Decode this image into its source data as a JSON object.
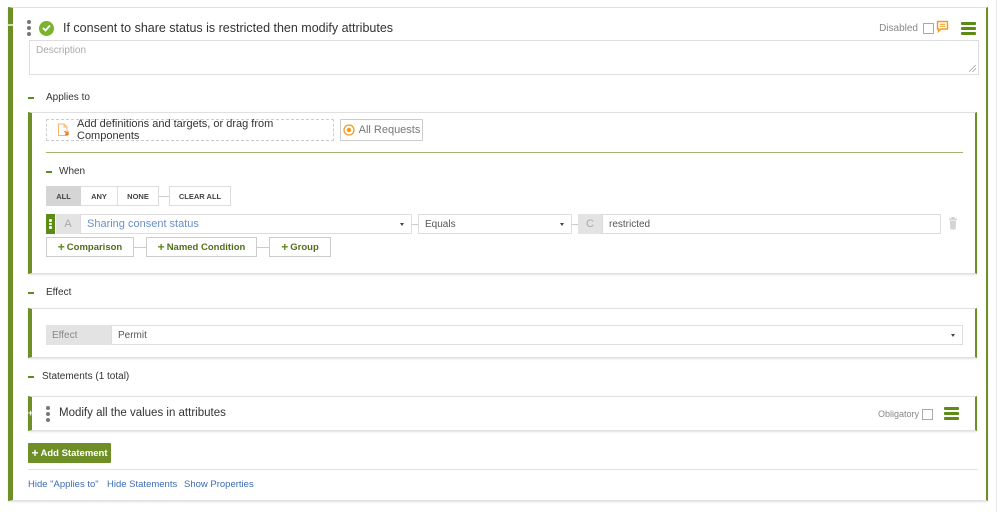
{
  "rule": {
    "title": "If consent to share status is restricted then modify attributes",
    "status_icon": "check-circle-icon",
    "disabled_label": "Disabled",
    "disabled_checked": false,
    "comment_icon": "comment-icon",
    "menu_icon": "hamburger-menu-icon",
    "description_placeholder": "Description",
    "description_value": ""
  },
  "applies_to": {
    "section_label": "Applies to",
    "add_definitions_label": "Add definitions and targets, or drag from Components",
    "all_requests_label": "All Requests",
    "when": {
      "label": "When",
      "match_modes": [
        "ALL",
        "ANY",
        "NONE"
      ],
      "active_mode": "ALL",
      "clear_all_label": "CLEAR ALL"
    },
    "condition": {
      "left_tag": "A",
      "attribute": "Sharing consent status",
      "operator": "Equals",
      "right_tag": "C",
      "value": "restricted"
    },
    "add_buttons": {
      "comparison": "Comparison",
      "named_condition": "Named Condition",
      "group": "Group"
    }
  },
  "effect": {
    "section_label": "Effect",
    "field_label": "Effect",
    "value": "Permit"
  },
  "statements": {
    "section_label": "Statements (1 total)",
    "items": [
      {
        "label": "Modify all the values in attributes",
        "obligatory_label": "Obligatory",
        "obligatory_checked": false
      }
    ],
    "add_label": "Add Statement"
  },
  "footer_links": {
    "hide_applies_to": "Hide \"Applies to\"",
    "hide_statements": "Hide Statements",
    "show_properties": "Show Properties"
  },
  "colors": {
    "accent_green": "#6e8f25",
    "button_green": "#5c8b16",
    "check_green": "#7ab32e",
    "link_blue": "#3c6cb3",
    "orange": "#f29b1d"
  }
}
